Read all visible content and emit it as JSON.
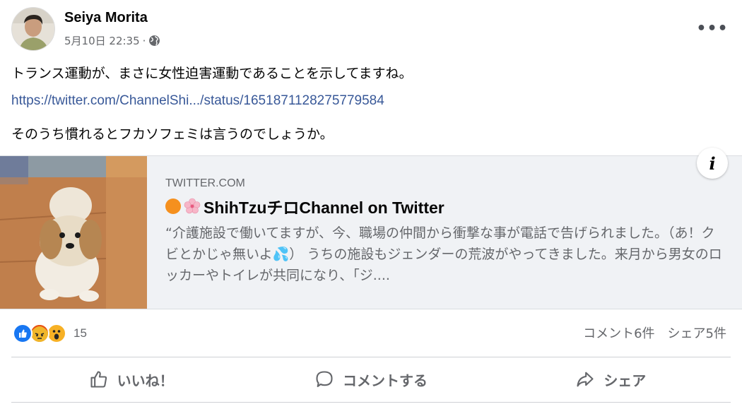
{
  "post": {
    "author": "Seiya Morita",
    "timestamp": "5月10日 22:35",
    "separator": "·",
    "privacy_icon": "globe-icon",
    "more_icon": "more-options-icon",
    "more_label": "•••",
    "text_line1": "トランス運動が、まさに女性迫害運動であることを示してますね。",
    "link_text": "https://twitter.com/ChannelShi.../status/1651871128275779584",
    "text_line2": "そのうち慣れるとフカソフェミは言うのでしょうか。"
  },
  "link_card": {
    "domain": "TWITTER.COM",
    "title": "ShihTzuチロChannel on Twitter",
    "description": "“介護施設で働いてますが、今、職場の仲間から衝撃な事が電話で告げられました。（あ！クビとかじゃ無いよ💦） うちの施設もジェンダーの荒波がやってきました。来月から男女のロッカーやトイレが共同になり、「ジ....",
    "info_label": "i",
    "thumbnail": "shih-tzu-dog-photo"
  },
  "engagement": {
    "reactions": [
      "like",
      "angry",
      "wow"
    ],
    "reaction_count": "15",
    "comments": "コメント6件",
    "shares": "シェア5件"
  },
  "actions": {
    "like": "いいね！",
    "comment": "コメントする",
    "share": "シェア"
  },
  "colors": {
    "link": "#385898",
    "like_blue": "#1877f2",
    "angry_orange": "#e9710f",
    "wow_yellow": "#f7b125",
    "card_bg": "#f0f2f5",
    "muted_text": "#65676b"
  }
}
